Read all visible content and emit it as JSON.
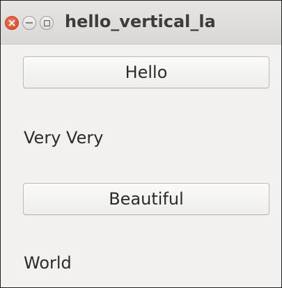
{
  "window": {
    "title": "hello_vertical_la",
    "controls": {
      "close_icon": "close-icon",
      "minimize_icon": "minimize-icon",
      "maximize_icon": "maximize-icon"
    }
  },
  "content": {
    "button_1": "Hello",
    "label_1": "Very Very",
    "button_2": "Beautiful",
    "label_2": "World"
  },
  "colors": {
    "close_button": "#e24f2e",
    "titlebar": "#dfdedb",
    "window_background": "#f2f1f0",
    "text": "#2b2b2b"
  }
}
